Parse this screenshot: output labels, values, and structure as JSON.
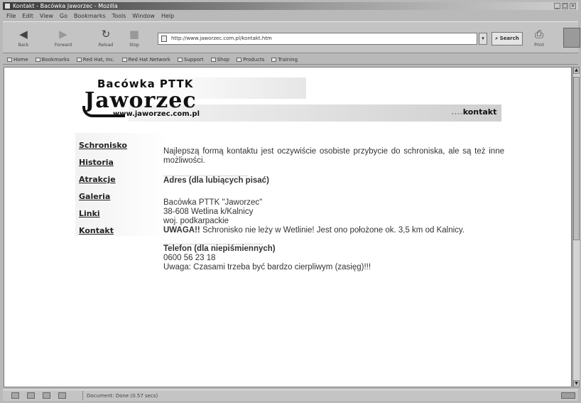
{
  "window": {
    "title": "Kontakt - Bacówka Jaworzec - Mozilla"
  },
  "menu": [
    "File",
    "Edit",
    "View",
    "Go",
    "Bookmarks",
    "Tools",
    "Window",
    "Help"
  ],
  "toolbar": {
    "back": "Back",
    "forward": "Forward",
    "reload": "Reload",
    "stop": "Stop",
    "url": "http://www.jaworzec.com.pl/kontakt.htm",
    "search": "Search",
    "print": "Print"
  },
  "bookmarks": [
    "Home",
    "Bookmarks",
    "Red Hat, Inc.",
    "Red Hat Network",
    "Support",
    "Shop",
    "Products",
    "Training"
  ],
  "page": {
    "logo_top": "Bacówka PTTK",
    "logo_main": "Jaworzec",
    "logo_url": "www.jaworzec.com.pl",
    "section_title": "kontakt",
    "nav": [
      "Schronisko",
      "Historia",
      "Atrakcje",
      "Galeria",
      "Linki",
      "Kontakt"
    ],
    "intro": "Najlepszą formą kontaktu jest oczywiście osobiste przybycie do schroniska, ale są też inne możliwości.",
    "address_heading": "Adres (dla lubiących pisać)",
    "address_lines": [
      "Bacówka PTTK \"Jaworzec\"",
      "38-608 Wetlina k/Kalnicy",
      "woj. podkarpackie"
    ],
    "warning_label": "UWAGA!!",
    "warning_text": " Schronisko nie leży w Wetlinie! Jest ono położone ok. 3,5 km od Kalnicy.",
    "phone_heading": "Telefon (dla niepiśmiennych)",
    "phone_number": "0600 56 23 18",
    "phone_note": "Uwaga: Czasami trzeba być bardzo cierpliwym (zasięg)!!!"
  },
  "status": {
    "message": "Document: Done (0.57 secs)"
  }
}
